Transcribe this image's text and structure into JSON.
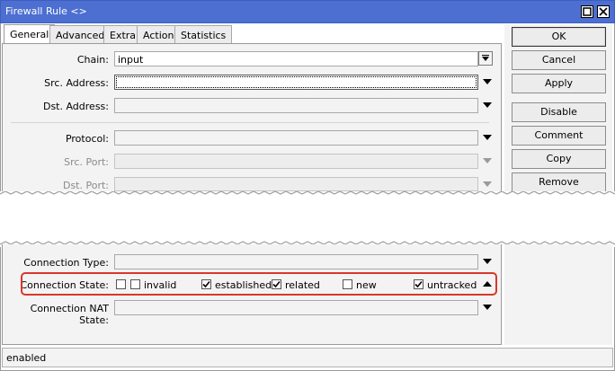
{
  "window": {
    "title": "Firewall Rule <>"
  },
  "tabs": [
    {
      "label": "General",
      "active": true
    },
    {
      "label": "Advanced",
      "active": false
    },
    {
      "label": "Extra",
      "active": false
    },
    {
      "label": "Action",
      "active": false
    },
    {
      "label": "Statistics",
      "active": false
    }
  ],
  "fields": {
    "chain": {
      "label": "Chain:",
      "value": "input"
    },
    "src_address": {
      "label": "Src. Address:",
      "value": ""
    },
    "dst_address": {
      "label": "Dst. Address:",
      "value": ""
    },
    "protocol": {
      "label": "Protocol:",
      "value": ""
    },
    "src_port": {
      "label": "Src. Port:",
      "value": ""
    },
    "dst_port": {
      "label": "Dst. Port:",
      "value": ""
    },
    "connection_type": {
      "label": "Connection Type:",
      "value": ""
    },
    "connection_state": {
      "label": "Connection State:"
    },
    "connection_nat_state": {
      "label": "Connection NAT State:",
      "value": ""
    }
  },
  "connection_states": [
    {
      "label": "invalid",
      "checked": false
    },
    {
      "label": "established",
      "checked": true
    },
    {
      "label": "related",
      "checked": true
    },
    {
      "label": "new",
      "checked": false
    },
    {
      "label": "untracked",
      "checked": true
    }
  ],
  "buttons": {
    "ok": "OK",
    "cancel": "Cancel",
    "apply": "Apply",
    "disable": "Disable",
    "comment": "Comment",
    "copy": "Copy",
    "remove": "Remove"
  },
  "status": {
    "text": "enabled"
  },
  "colors": {
    "titlebar": "#4c6fd1",
    "highlight": "#d9372b"
  }
}
